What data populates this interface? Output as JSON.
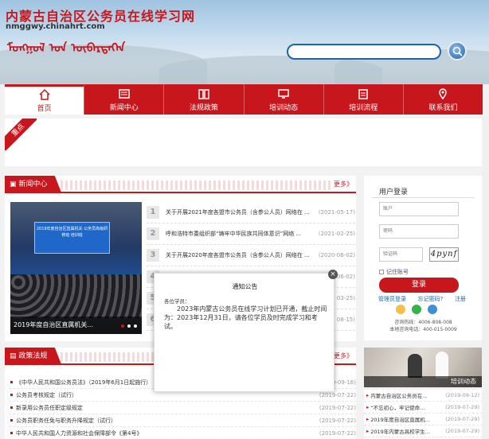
{
  "header": {
    "title": "内蒙古自治区公务员在线学习网",
    "domain": "nmggwy.chinahrt.com",
    "mongolian": "ᠮᠣᠩᠭᠣᠯ ᠤᠨ ᠥᠪᠡᠷᠲᠡᠭᠡᠨ",
    "search_placeholder": ""
  },
  "nav": [
    {
      "label": "首页",
      "icon": "home-icon",
      "active": true
    },
    {
      "label": "新闻中心",
      "icon": "newspaper-icon"
    },
    {
      "label": "法规政策",
      "icon": "book-icon"
    },
    {
      "label": "培训动态",
      "icon": "monitor-icon"
    },
    {
      "label": "培训流程",
      "icon": "clipboard-icon"
    },
    {
      "label": "联系我们",
      "icon": "location-icon"
    }
  ],
  "focus_badge": "重点",
  "news": {
    "section": "新闻中心",
    "more": "更多》",
    "photo_caption": "2019年度自治区直属机关...",
    "photo_screen_text": "2019年度自治区直属机关 公务员高级研修班 培训班",
    "items": [
      {
        "num": "1",
        "title": "关于开展2021年度各盟市公务员（含参公人员）网络在 ...",
        "date": "(2021-05-17)"
      },
      {
        "num": "2",
        "title": "呼和浩特市委组织部“铸牢中华民族共同体意识”网络 ...",
        "date": "(2021-02-25)"
      },
      {
        "num": "3",
        "title": "关于开展2020年度各盟市公务员（含参公人员）网络在 ...",
        "date": "(2020-06-02)"
      },
      {
        "num": "4",
        "title": "",
        "date": "06-02)"
      },
      {
        "num": "5",
        "title": "",
        "date": "03-25)"
      },
      {
        "num": "6",
        "title": "",
        "date": "08-15)"
      }
    ]
  },
  "laws": {
    "section": "政策法规",
    "more": "更多》",
    "items": [
      {
        "title": "《中华人民共和国公务员法》（2019年6月1日起施行）",
        "date": "(2019-09-16)"
      },
      {
        "title": "公务员考核规定（试行）",
        "date": "(2019-07-22)"
      },
      {
        "title": "新录用公务员任职定级规定",
        "date": "(2019-07-22)"
      },
      {
        "title": "公务员职务任免与职务升降规定（试行）",
        "date": "(2019-07-22)"
      },
      {
        "title": "中华人民共和国人力资源和社会保障部令《第4号》",
        "date": "(2019-07-22)"
      }
    ]
  },
  "login": {
    "title": "用户登录",
    "username_placeholder": "账户",
    "password_placeholder": "密码",
    "captcha_placeholder": "验证码",
    "captcha": "4pynf",
    "remember": "记住账号",
    "button": "登录",
    "links": [
      "管理员登录",
      "忘记密码?",
      "注册"
    ],
    "support": "咨询热线：4006-808-008",
    "phone": "本地咨询电话：400-015-0009"
  },
  "training": {
    "label": "培训动态",
    "items": [
      {
        "title": "内蒙古自治区公务员在...",
        "date": "(2019-09-12)"
      },
      {
        "title": "“不忘初心，牢记使命...",
        "date": "(2019-07-29)"
      },
      {
        "title": "2019年度自治区直属机...",
        "date": "(2019-07-29)"
      },
      {
        "title": "2019年内蒙古高校学生...",
        "date": "(2019-07-29)"
      }
    ]
  },
  "notice": {
    "title": "通知公告",
    "greeting": "各位学员：",
    "body": "2023年内蒙古公务员在线学习计划已开通，截止时间为：2023年12月31日，请各位学员及时完成学习和考试。",
    "close": "×"
  },
  "colors": {
    "accent": "#c8161d",
    "link": "#1c63b0"
  }
}
